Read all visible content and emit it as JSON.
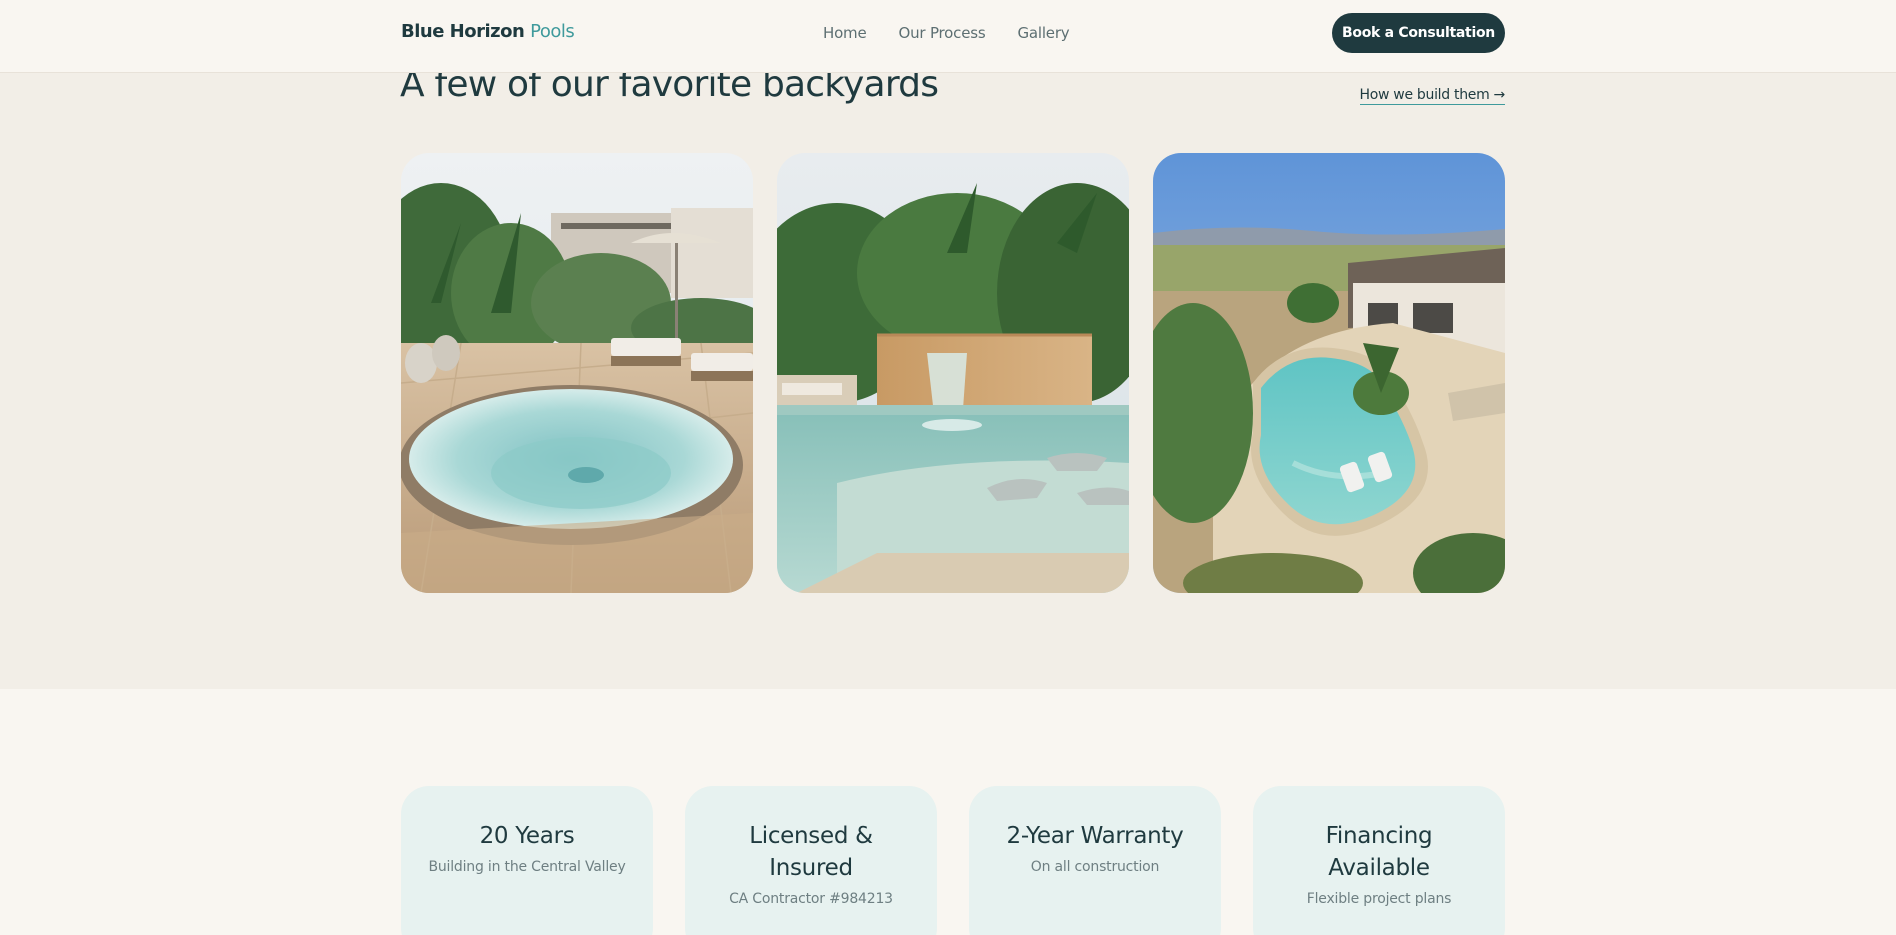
{
  "header": {
    "logo_main": "Blue Horizon",
    "logo_accent": "Pools",
    "nav": [
      "Home",
      "Our Process",
      "Gallery"
    ],
    "cta_label": "Book a Consultation"
  },
  "gallery": {
    "title": "A few of our favorite backyards",
    "link_label": "How we build them →",
    "images": [
      {
        "name": "spa-patio-photo"
      },
      {
        "name": "waterfall-pool-photo"
      },
      {
        "name": "freeform-pool-aerial-photo"
      }
    ]
  },
  "stats": [
    {
      "title": "20 Years",
      "subtitle": "Building in the Central Valley"
    },
    {
      "title": "Licensed & Insured",
      "subtitle": "CA Contractor #984213"
    },
    {
      "title": "2-Year Warranty",
      "subtitle": "On all construction"
    },
    {
      "title": "Financing Available",
      "subtitle": "Flexible project plans"
    }
  ],
  "colors": {
    "brand_dark": "#1f3a3f",
    "brand_accent": "#3f9a9c",
    "page_bg": "#f9f6f1",
    "gallery_bg": "#f2eee7",
    "stat_bg": "#e7f2f0"
  }
}
